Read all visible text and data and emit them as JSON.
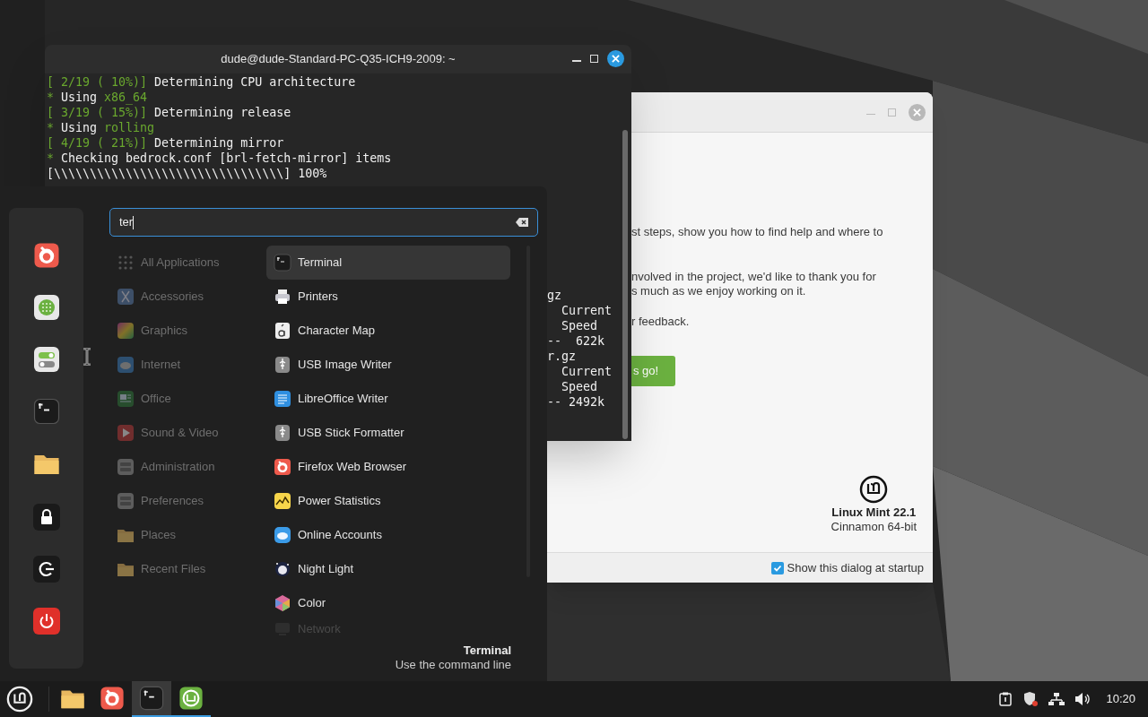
{
  "terminal": {
    "title": "dude@dude-Standard-PC-Q35-ICH9-2009: ~",
    "lines": [
      [
        {
          "kind": "accent",
          "text": "[ 2/19 ( 10%)]"
        },
        {
          "kind": "plain",
          "text": " Determining CPU architecture"
        }
      ],
      [
        {
          "kind": "accent",
          "text": "*"
        },
        {
          "kind": "plain",
          "text": " Using "
        },
        {
          "kind": "accent",
          "text": "x86_64"
        }
      ],
      [
        {
          "kind": "accent",
          "text": "[ 3/19 ( 15%)]"
        },
        {
          "kind": "plain",
          "text": " Determining release"
        }
      ],
      [
        {
          "kind": "accent",
          "text": "*"
        },
        {
          "kind": "plain",
          "text": " Using "
        },
        {
          "kind": "accent",
          "text": "rolling"
        }
      ],
      [
        {
          "kind": "accent",
          "text": "[ 4/19 ( 21%)]"
        },
        {
          "kind": "plain",
          "text": " Determining mirror"
        }
      ],
      [
        {
          "kind": "accent",
          "text": "*"
        },
        {
          "kind": "plain",
          "text": " Checking bedrock.conf [brl-fetch-mirror] items"
        }
      ],
      [
        {
          "kind": "plain",
          "text": "[\\\\\\\\\\\\\\\\\\\\\\\\\\\\\\\\\\\\\\\\\\\\\\\\\\\\\\\\\\\\\\\\] 100%"
        }
      ]
    ],
    "tail_fragments": [
      "gz",
      "  Current",
      "  Speed",
      "--  622k",
      "r.gz",
      "  Current",
      "  Speed",
      "-- 2492k"
    ]
  },
  "welcome": {
    "paragraphs": [
      [
        "st steps, show you how to find help and where to"
      ],
      [
        "nvolved in the project, we'd like to thank you for",
        "s much as we enjoy working on it."
      ],
      [
        "r feedback."
      ]
    ],
    "button": "s go!",
    "product": "Linux Mint 22.1",
    "edition": "Cinnamon 64-bit",
    "startup_checkbox": {
      "label": "Show this dialog at startup",
      "checked": true
    }
  },
  "menu": {
    "search": {
      "value": "ter"
    },
    "categories": [
      {
        "kind": "all",
        "label": "All Applications",
        "disabled": true
      },
      {
        "kind": "accessories",
        "label": "Accessories",
        "disabled": true
      },
      {
        "kind": "graphics",
        "label": "Graphics",
        "disabled": true
      },
      {
        "kind": "internet",
        "label": "Internet",
        "disabled": true
      },
      {
        "kind": "office",
        "label": "Office",
        "disabled": true
      },
      {
        "kind": "media",
        "label": "Sound & Video",
        "disabled": true
      },
      {
        "kind": "admin",
        "label": "Administration",
        "disabled": true
      },
      {
        "kind": "prefs",
        "label": "Preferences",
        "disabled": true
      },
      {
        "kind": "places",
        "label": "Places",
        "disabled": true
      },
      {
        "kind": "recent",
        "label": "Recent Files",
        "disabled": true
      }
    ],
    "apps": [
      {
        "kind": "terminal",
        "label": "Terminal",
        "selected": true,
        "faded": false
      },
      {
        "kind": "printer",
        "label": "Printers",
        "selected": false,
        "faded": false
      },
      {
        "kind": "charmap",
        "label": "Character Map",
        "selected": false,
        "faded": false
      },
      {
        "kind": "usb",
        "label": "USB Image Writer",
        "selected": false,
        "faded": false
      },
      {
        "kind": "writer",
        "label": "LibreOffice Writer",
        "selected": false,
        "faded": false
      },
      {
        "kind": "usb",
        "label": "USB Stick Formatter",
        "selected": false,
        "faded": false
      },
      {
        "kind": "firefox",
        "label": "Firefox Web Browser",
        "selected": false,
        "faded": false
      },
      {
        "kind": "power",
        "label": "Power Statistics",
        "selected": false,
        "faded": false
      },
      {
        "kind": "cloud",
        "label": "Online Accounts",
        "selected": false,
        "faded": false
      },
      {
        "kind": "night",
        "label": "Night Light",
        "selected": false,
        "faded": false
      },
      {
        "kind": "color",
        "label": "Color",
        "selected": false,
        "faded": false
      },
      {
        "kind": "network",
        "label": "Network",
        "selected": false,
        "faded": true
      }
    ],
    "description": {
      "title": "Terminal",
      "text": "Use the command line"
    }
  },
  "taskbar": {
    "apps": [
      {
        "kind": "files",
        "running": false,
        "focused": false
      },
      {
        "kind": "firefox",
        "running": false,
        "focused": false
      },
      {
        "kind": "terminal",
        "running": true,
        "focused": true
      },
      {
        "kind": "welcome",
        "running": true,
        "focused": false
      }
    ],
    "clock": "10:20"
  }
}
